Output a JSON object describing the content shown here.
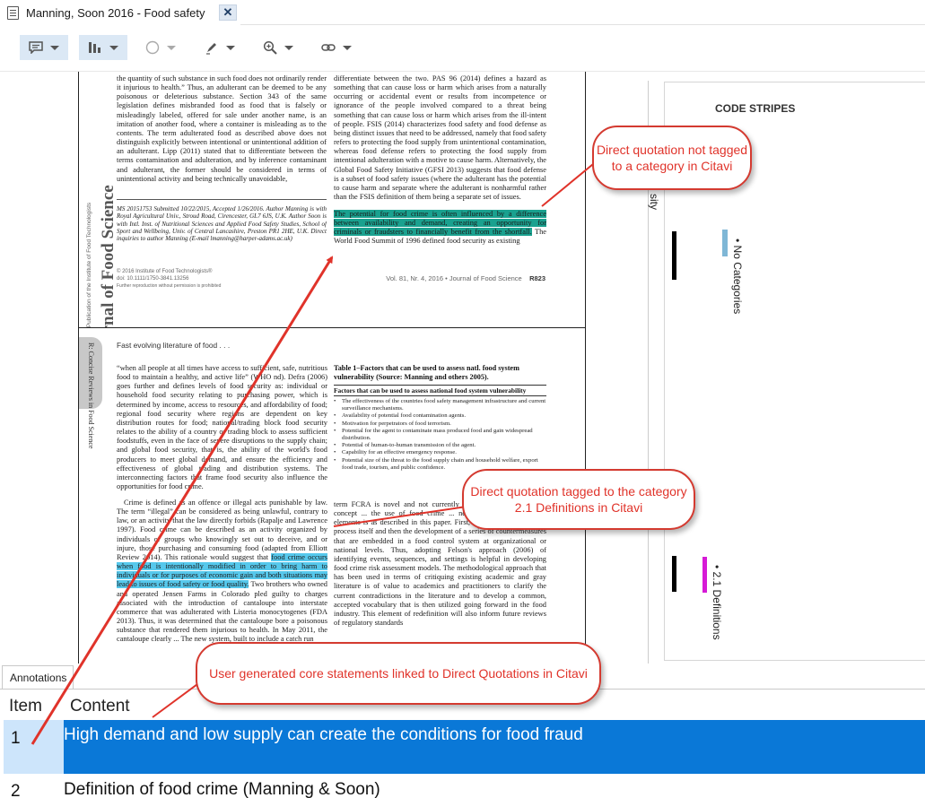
{
  "tab": {
    "title": "Manning, Soon 2016 - Food safety",
    "close_glyph": "✕"
  },
  "toolbar": {
    "items": [
      "comment-icon",
      "bars-icon",
      "circle-icon",
      "highlighter-icon",
      "zoom-icon",
      "link-icon"
    ]
  },
  "page1": {
    "left_col": "the quantity of such substance in such food does not ordinarily render it injurious to health.” Thus, an adulterant can be deemed to be any poisonous or deleterious substance. Section 343 of the same legislation defines misbranded food as food that is falsely or misleadingly labeled, offered for sale under another name, is an imitation of another food, where a container is misleading as to the contents. The term adulterated food as described above does not distinguish explicitly between intentional or unintentional addition of an adulterant. Lipp (2011) stated that to differentiate between the terms contamination and adulteration, and by inference contaminant and adulterant, the former should be considered in terms of unintentional activity and being technically unavoidable,",
    "left_note": "MS 20151753 Submitted 10/22/2015, Accepted 1/26/2016. Author Manning is with Royal Agricultural Univ., Stroud Road, Cirencester, GL7 6JS, U.K. Author Soon is with Intl. Inst. of Nutritional Sciences and Applied Food Safety Studies, School of Sport and Wellbeing, Univ. of Central Lancashire, Preston PR1 2HE, U.K. Direct inquiries to author Manning (E-mail lmanning@harper-adams.ac.uk)",
    "copyright": "© 2016 Institute of Food Technologists®",
    "doi": "doi: 10.1111/1750-3841.13256",
    "reproduction": "Further reproduction without permission is prohibited",
    "right_col": "differentiate between the two. PAS 96 (2014) defines a hazard as something that can cause loss or harm which arises from a naturally occurring or accidental event or results from incompetence or ignorance of the people involved compared to a threat being something that can cause loss or harm which arises from the ill-intent of people. FSIS (2014) characterizes food safety and food defense as being distinct issues that need to be addressed, namely that food safety refers to protecting the food supply from unintentional contamination, whereas food defense refers to protecting the food supply from intentional adulteration with a motive to cause harm. Alternatively, the Global Food Safety Initiative (GFSI 2013) suggests that food defense is a subset of food safety issues (where the adulterant has the potential to cause harm and separate where the adulterant is nonharmful rather than the FSIS definition of them being a separate set of issues.",
    "green_hl": "The potential for food crime is often influenced by a difference between availability and demand, creating an opportunity for criminals or fraudsters to financially benefit from the shortfall.",
    "after_hl": " The World Food Summit of 1996 defined food security as existing",
    "footer": "Vol. 81, Nr. 4, 2016 • Journal of Food Science",
    "page_no": "R823",
    "journal": "Journal of Food Science",
    "journal_sub": "A Publication of the Institute of Food Technologists"
  },
  "page2": {
    "header": "Fast evolving literature of food . . .",
    "review_tab": "R: Concise Reviews in Food Science",
    "left_a": "“when all people at all times have access to sufficient, safe, nutritious food to maintain a healthy, and active life” (WHO nd). Defra (2006) goes further and defines levels of food security as: individual or household food security relating to purchasing power, which is determined by income, access to resources, and affordability of food; regional food security where regions are dependent on key distribution routes for food; national/trading block food security relates to the ability of a country or trading block to assess sufficient foodstuffs, even in the face of severe disruptions to the supply chain; and global food security, that is, the ability of the world's food producers to meet global demand, and ensure the efficiency and effectiveness of global trading and distribution systems. The interconnecting factors that frame food security also influence the opportunities for food crime.",
    "left_b_pre": "Crime is defined as an offence or illegal acts punishable by law. The term “illegal” can be considered as being unlawful, contrary to law, or an activity that the law directly forbids (Rapalje and Lawrence 1997). Food crime can be described as an activity organized by individuals or groups who knowingly set out to deceive, and or injure, those purchasing and consuming food (adapted from Elliott Review 2014). This rationale would suggest that ",
    "left_b_hl": "food crime occurs when food is intentionally modified in order to bring harm to individuals or for purposes of economic gain and both situations may lead to issues of food safety or food quality.",
    "left_b_post": " Two brothers who owned and operated Jensen Farms in Colorado pled guilty to charges associated with the introduction of cantaloupe into interstate commerce that was adulterated with Listeria monocytogenes (FDA 2013). Thus, it was determined that the cantaloupe bore a poisonous substance that rendered them injurious to health. In May 2011, the cantaloupe clearly ... The new system, built to include a catch run",
    "table_title": "Table 1–Factors that can be used to assess natl. food system vulnerability (Source: Manning and others 2005).",
    "table_head": "Factors that can be used to assess national food system vulnerability",
    "table_items": [
      "The effectiveness of the countries food safety management infrastructure and current surveillance mechanisms.",
      "Availability of potential food contamination agents.",
      "Motivation for perpetrators of food terrorism.",
      "Potential for the agent to contaminate mass produced food and gain widespread distribution.",
      "Potential of human-to-human transmission of the agent.",
      "Capability for an effective emergency response.",
      "Potential size of the threat to the food supply chain and household welfare, export food trade, tourism, and public confidence."
    ],
    "right_b": "term FCRA is novel and not currently ... as such is an evolving concept ... the use of food crime ... network ... they contain ... elements is as described in this paper. First, there ... risk assessment process itself and then the development of a series of countermeasures that are embedded in a food control system at organizational or national levels. Thus, adopting Felson's approach (2006) of identifying events, sequences, and settings is helpful in developing food crime risk assessment models. The methodological approach that has been used in terms of critiquing existing academic and gray literature is of value to academics and practitioners to clarify the current contradictions in the literature and to develop a common, accepted vocabulary that is then utilized going forward in the food industry. This element of redefinition will also inform future reviews of regulatory standards"
  },
  "stripes": {
    "title": "CODE STRIPES",
    "label_top": "sity",
    "no_categories": "• No Categories",
    "definitions": "• 2.1 Definitions",
    "colors": {
      "no_cat": "#7fb7d6",
      "definitions": "#d61ad6",
      "marker": "#000000"
    }
  },
  "annotations": {
    "tab_label": "Annotations",
    "col_item": "Item",
    "col_content": "Content",
    "rows": [
      {
        "item": "1",
        "content": "High demand and low supply can create the conditions for food fraud"
      },
      {
        "item": "2",
        "content": "Definition of food crime (Manning & Soon)"
      }
    ]
  },
  "callouts": {
    "c1": "Direct quotation not tagged to a category in Citavi",
    "c2": "Direct quotation tagged to the category 2.1 Definitions in Citavi",
    "c3": "User generated core statements linked to Direct Quotations in Citavi"
  },
  "colors": {
    "selection": "#0a78d7",
    "callout": "#e0332a",
    "green_highlight": "#1aa18f",
    "cyan_highlight": "#56c8ec"
  }
}
